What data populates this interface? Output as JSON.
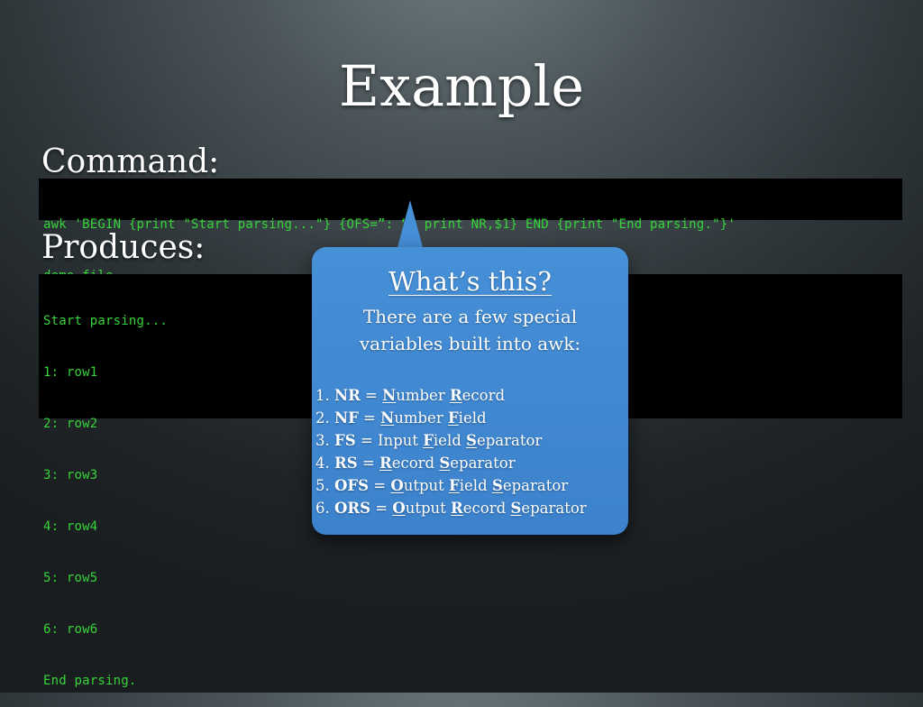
{
  "slide": {
    "title": "Example"
  },
  "command_section": {
    "label": "Command:",
    "lines": [
      "awk 'BEGIN {print \"Start parsing...\"} {OFS=”: “; print NR,$1} END {print \"End parsing.\"}'",
      "demo_file"
    ]
  },
  "output_section": {
    "label": "Produces:",
    "lines": [
      "Start parsing...",
      "1: row1",
      "2: row2",
      "3: row3",
      "4: row4",
      "5: row5",
      "6: row6",
      "End parsing."
    ]
  },
  "callout": {
    "heading": "What’s this?",
    "intro_line1": "There are a few special",
    "intro_line2": "variables built into awk:",
    "variables": [
      {
        "num": "1.",
        "abbr": "NR",
        "eq": " = ",
        "first": "N",
        "rest": "umber ",
        "second_first": "R",
        "second_rest": "ecord",
        "third_first": "",
        "third_rest": ""
      },
      {
        "num": "2.",
        "abbr": "NF",
        "eq": " = ",
        "first": "N",
        "rest": "umber ",
        "second_first": "F",
        "second_rest": "ield",
        "third_first": "",
        "third_rest": ""
      },
      {
        "num": "3.",
        "abbr": "FS",
        "eq": " = ",
        "first": "",
        "rest": "Input ",
        "second_first": "F",
        "second_rest": "ield ",
        "third_first": "S",
        "third_rest": "eparator"
      },
      {
        "num": "4.",
        "abbr": "RS",
        "eq": " = ",
        "first": "R",
        "rest": "ecord ",
        "second_first": "S",
        "second_rest": "eparator",
        "third_first": "",
        "third_rest": ""
      },
      {
        "num": "5.",
        "abbr": "OFS",
        "eq": " = ",
        "first": "O",
        "rest": "utput ",
        "second_first": "F",
        "second_rest": "ield ",
        "third_first": "S",
        "third_rest": "eparator"
      },
      {
        "num": "6.",
        "abbr": "ORS",
        "eq": " = ",
        "first": "O",
        "rest": "utput ",
        "second_first": "R",
        "second_rest": "ecord ",
        "third_first": "S",
        "third_rest": "eparator"
      }
    ]
  },
  "colors": {
    "terminal_text": "#37d43a",
    "terminal_bg": "#000000",
    "callout_bg": "#4690d8"
  }
}
